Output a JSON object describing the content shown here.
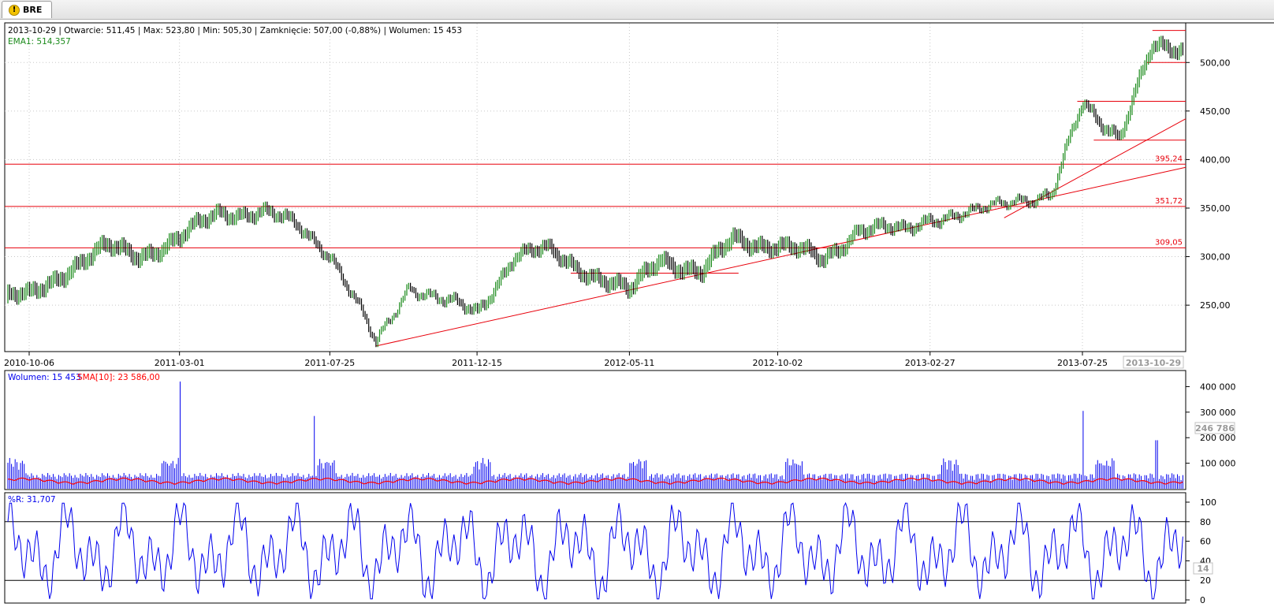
{
  "tab": {
    "label": "BRE",
    "icon": "warning-icon"
  },
  "info": {
    "ohlc_line": "2013-10-29 | Otwarcie: 511,45 | Max: 523,80 | Min: 505,30 | Zamknięcie: 507,00 (-0,88%)  | Wolumen: 15 453",
    "ema_line": "EMA1: 514,357"
  },
  "colors": {
    "price_up": "#1a8a1a",
    "price_bar": "#000000",
    "support": "#e8000b",
    "volume": "#0000ee",
    "sma": "#ff0000",
    "williams": "#0000ee"
  },
  "chart_data": [
    {
      "type": "line",
      "title": "",
      "xlabel": "",
      "ylabel": "",
      "x_ticks": [
        "2010-10-06",
        "2011-03-01",
        "2011-07-25",
        "2011-12-15",
        "2012-05-11",
        "2012-10-02",
        "2013-02-27",
        "2013-07-25"
      ],
      "last_date_label": "2013-10-29",
      "y_ticks": [
        "250,00",
        "300,00",
        "350,00",
        "400,00",
        "450,00",
        "500,00"
      ],
      "ylim": [
        203,
        540
      ],
      "series": [
        {
          "name": "EMA1",
          "x": [
            "2010-10-06",
            "2010-11-15",
            "2010-12-20",
            "2011-01-20",
            "2011-03-01",
            "2011-04-10",
            "2011-05-20",
            "2011-06-25",
            "2011-07-25",
            "2011-08-15",
            "2011-09-08",
            "2011-10-10",
            "2011-11-15",
            "2011-12-15",
            "2012-01-20",
            "2012-02-20",
            "2012-04-05",
            "2012-05-11",
            "2012-06-10",
            "2012-07-20",
            "2012-08-20",
            "2012-10-02",
            "2012-11-15",
            "2012-12-20",
            "2013-02-01",
            "2013-02-27",
            "2013-04-10",
            "2013-05-20",
            "2013-06-25",
            "2013-07-25",
            "2013-08-30",
            "2013-09-30",
            "2013-10-29"
          ],
          "values": [
            258,
            290,
            308,
            302,
            318,
            346,
            346,
            330,
            305,
            262,
            208,
            272,
            252,
            242,
            302,
            305,
            283,
            262,
            300,
            282,
            318,
            312,
            296,
            330,
            325,
            342,
            342,
            362,
            360,
            458,
            425,
            512,
            514
          ]
        }
      ],
      "levels": [
        {
          "label": "395,24",
          "value": 395.24
        },
        {
          "label": "351,72",
          "value": 351.72
        },
        {
          "label": "309,05",
          "value": 309.05
        }
      ]
    },
    {
      "type": "bar",
      "title": "",
      "legend": [
        "Wolumen: 15 453",
        "SMA[10]: 23 586,00"
      ],
      "y_ticks": [
        "100 000",
        "200 000",
        "300 000",
        "400 000"
      ],
      "ylim": [
        0,
        460000
      ],
      "marker_label": "246 786",
      "spikes": [
        {
          "date": "2011-03-01",
          "value": 420000
        },
        {
          "date": "2011-07-10",
          "value": 285000
        },
        {
          "date": "2013-07-25",
          "value": 305000
        },
        {
          "date": "2013-10-05",
          "value": 190000
        }
      ]
    },
    {
      "type": "line",
      "title": "",
      "legend": [
        "%R: 31,707"
      ],
      "y_ticks": [
        "0",
        "20",
        "40",
        "60",
        "80",
        "100"
      ],
      "ylim": [
        0,
        100
      ],
      "levels": [
        80,
        20
      ],
      "marker_label": "14"
    }
  ]
}
